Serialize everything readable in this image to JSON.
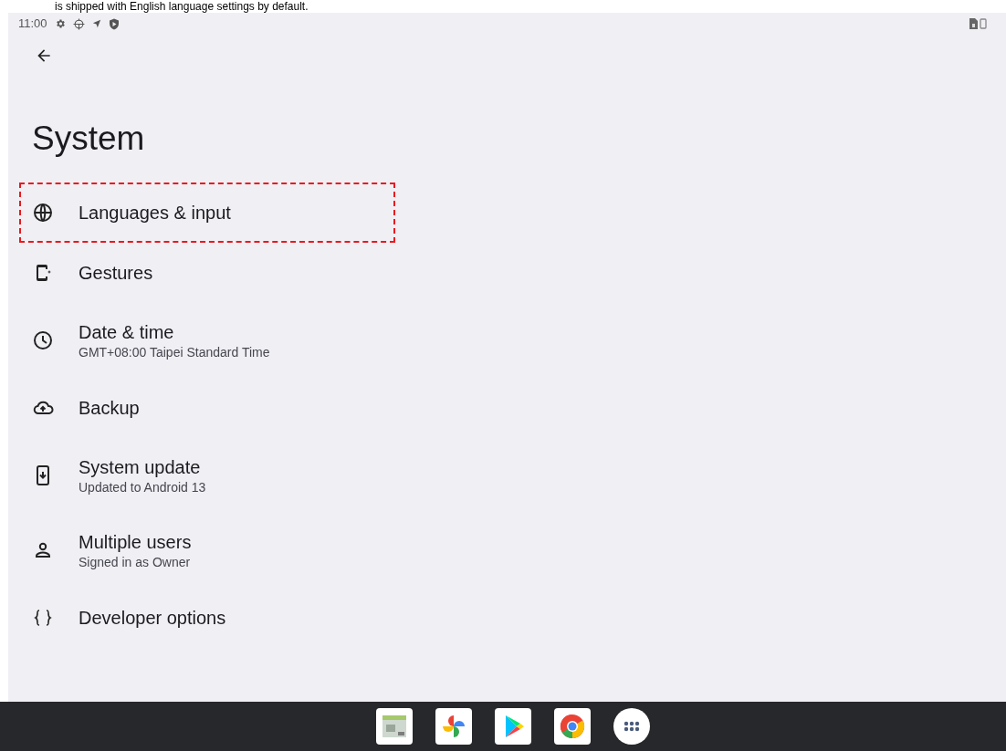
{
  "caption": "is shipped with English language settings by default.",
  "status_bar": {
    "time": "11:00"
  },
  "title": "System",
  "items": [
    {
      "label": "Languages & input",
      "highlighted": true
    },
    {
      "label": "Gestures",
      "highlighted": false
    },
    {
      "label": "Date & time",
      "summary": "GMT+08:00 Taipei Standard Time",
      "highlighted": false
    },
    {
      "label": "Backup",
      "highlighted": false
    },
    {
      "label": "System update",
      "summary": "Updated to Android 13",
      "highlighted": false
    },
    {
      "label": "Multiple users",
      "summary": "Signed in as Owner",
      "highlighted": false
    },
    {
      "label": "Developer options",
      "highlighted": false
    }
  ]
}
